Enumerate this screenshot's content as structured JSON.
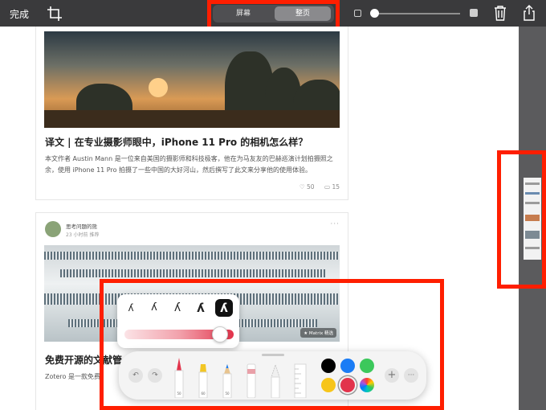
{
  "toolbar": {
    "done_label": "完成",
    "segment": {
      "screen_label": "屏幕",
      "fullpage_label": "整页",
      "selected": "整页"
    },
    "opacity_level": 0.0,
    "icons": [
      "crop-icon",
      "trash-icon",
      "share-icon"
    ]
  },
  "articles": [
    {
      "title": "译文 | 在专业摄影师眼中，iPhone 11 Pro 的相机怎么样？",
      "description": "本文作者 Austin Mann 是一位来自美国的摄影师和科技极客，他在为马友友的巴赫巡演计划拍摄照之余，使用 iPhone 11 Pro 拍摄了一些中国的大好河山，然后撰写了此文来分享他的使用体验。",
      "likes": "50",
      "comments": "15"
    },
    {
      "author": "思考问题的熊",
      "meta": "23 小时前 推荐",
      "image_badge": "★ Matrix 精选",
      "title": "免费开源的文献管",
      "description": "Zotero 是一款免费"
    }
  ],
  "markup_tools": {
    "stroke_styles": [
      "ʎ",
      "ʎ",
      "ʎ",
      "ʎ",
      "ʎ"
    ],
    "selected_stroke_index": 4,
    "opacity": 0.8,
    "tools": [
      "pen-tool",
      "marker-tool",
      "pencil-tool",
      "eraser-tool",
      "lasso-tool",
      "ruler-tool"
    ],
    "colors": [
      "#000000",
      "#1a7cf5",
      "#3cc85b",
      "#f7c51a",
      "#e2334b"
    ],
    "selected_color": "#e2334b"
  },
  "annotation_colors": {
    "highlight_box": "#ff1e00"
  }
}
